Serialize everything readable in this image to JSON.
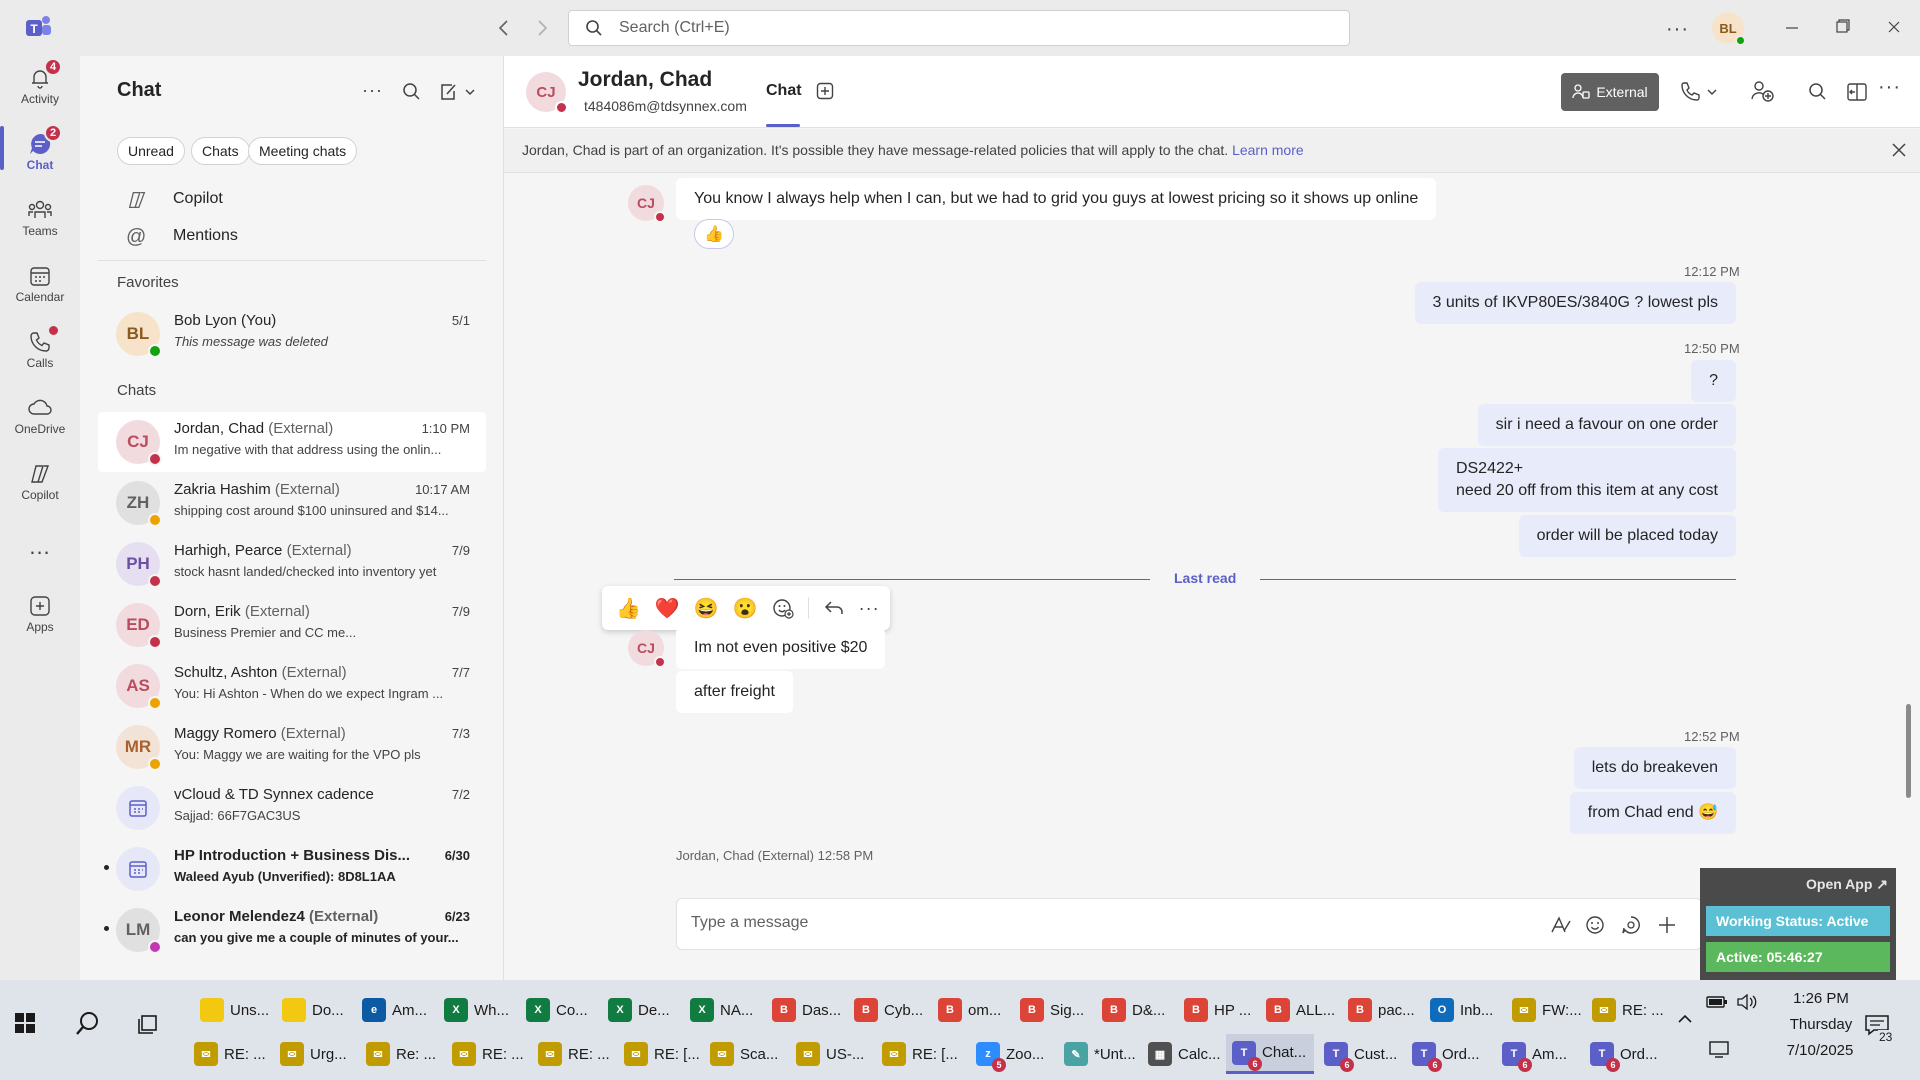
{
  "search": {
    "placeholder": "Search (Ctrl+E)"
  },
  "user": {
    "initials": "BL"
  },
  "rail": [
    {
      "label": "Activity",
      "badge": "4",
      "icon": "bell-icon"
    },
    {
      "label": "Chat",
      "badge": "2",
      "icon": "chat-icon"
    },
    {
      "label": "Teams",
      "icon": "teams-icon"
    },
    {
      "label": "Calendar",
      "icon": "calendar-icon"
    },
    {
      "label": "Calls",
      "icon": "phone-icon"
    },
    {
      "label": "OneDrive",
      "icon": "cloud-icon"
    },
    {
      "label": "Copilot",
      "icon": "copilot-icon"
    },
    {
      "label": "...",
      "icon": "more-icon"
    },
    {
      "label": "Apps",
      "icon": "apps-icon"
    }
  ],
  "chatlist": {
    "title": "Chat",
    "filters": [
      "Unread",
      "Chats",
      "Meeting chats"
    ],
    "pinned": [
      "Copilot",
      "Mentions"
    ],
    "favorites_header": "Favorites",
    "chats_header": "Chats",
    "favorites": [
      {
        "initials": "BL",
        "name": "Bob Lyon (You)",
        "ext": "",
        "time": "5/1",
        "preview": "This message was deleted"
      }
    ],
    "chats": [
      {
        "initials": "CJ",
        "name": "Jordan, Chad",
        "ext": "(External)",
        "time": "1:10 PM",
        "preview": "Im negative with that address using the onlin...",
        "avatar_bg": "#f1dbdf",
        "avatar_fg": "#b94c5e",
        "presence": "#c4314b"
      },
      {
        "initials": "ZH",
        "name": "Zakria Hashim",
        "ext": "(External)",
        "time": "10:17 AM",
        "preview": "shipping cost around $100 uninsured and $14...",
        "avatar_bg": "#e0e0e0",
        "avatar_fg": "#616161",
        "presence": "#eaa300"
      },
      {
        "initials": "PH",
        "name": "Harhigh, Pearce",
        "ext": "(External)",
        "time": "7/9",
        "preview": "stock hasnt landed/checked into inventory yet",
        "avatar_bg": "#e6dff2",
        "avatar_fg": "#6b4fa3",
        "presence": "#c4314b"
      },
      {
        "initials": "ED",
        "name": "Dorn, Erik",
        "ext": "(External)",
        "time": "7/9",
        "preview": "Business Premier and CC me...",
        "avatar_bg": "#f1dbdf",
        "avatar_fg": "#b94c5e",
        "presence": "#c4314b"
      },
      {
        "initials": "AS",
        "name": "Schultz, Ashton",
        "ext": "(External)",
        "time": "7/7",
        "preview": "You: Hi Ashton -  When do we expect Ingram ...",
        "avatar_bg": "#f1dbdf",
        "avatar_fg": "#b94c5e",
        "presence": "#eaa300"
      },
      {
        "initials": "MR",
        "name": "Maggy Romero",
        "ext": "(External)",
        "time": "7/3",
        "preview": "You: Maggy we are waiting for the VPO pls",
        "avatar_bg": "#f3e3d6",
        "avatar_fg": "#a8612f",
        "presence": "#eaa300"
      },
      {
        "initials": "",
        "name": "vCloud & TD Synnex cadence",
        "ext": "",
        "time": "7/2",
        "preview": "Sajjad: 66F7GAC3US",
        "avatar_bg": "#e6e8f8",
        "avatar_fg": "#5b5fc7",
        "presence": ""
      },
      {
        "initials": "",
        "name": "HP Introduction + Business Dis...",
        "ext": "",
        "time": "6/30",
        "preview": "Waleed Ayub (Unverified): 8D8L1AA",
        "avatar_bg": "#e6e8f8",
        "avatar_fg": "#5b5fc7",
        "presence": "",
        "bold": true
      },
      {
        "initials": "LM",
        "name": "Leonor Melendez4",
        "ext": "(External)",
        "time": "6/23",
        "preview": "can you give me a couple of minutes of your...",
        "avatar_bg": "#e0e0e0",
        "avatar_fg": "#616161",
        "presence": "#c239b3",
        "bold": true
      }
    ]
  },
  "header": {
    "initials": "CJ",
    "name": "Jordan, Chad",
    "email": "t484086m@tdsynnex.com",
    "tab": "Chat",
    "external_label": "External"
  },
  "infobar": {
    "text": "Jordan, Chad is part of an organization. It's possible they have message-related policies that will apply to the chat.",
    "link": "Learn more"
  },
  "messages": {
    "m1": "You know I always help when I can, but we had to grid you guys at lowest pricing so it shows up online",
    "m1_reaction": "👍",
    "t1": "12:12 PM",
    "m2": "3 units of IKVP80ES/3840G ? lowest pls",
    "t2": "12:50 PM",
    "m3": "?",
    "m4": "sir i need a favour on one order",
    "m5a": "DS2422+",
    "m5b": "need 20 off from this item at any cost",
    "m6": "order will be placed today",
    "last_read": "Last read",
    "m7": "Im not even positive $20",
    "m8": "after freight",
    "t3": "12:52 PM",
    "m9": "lets do breakeven",
    "m10": "from Chad end 😅",
    "next_sender": "Jordan, Chad (External)   12:58 PM"
  },
  "reactions": [
    "👍",
    "❤️",
    "😆",
    "😮"
  ],
  "composer": {
    "placeholder": "Type a message"
  },
  "widget": {
    "open": "Open App ↗",
    "status": "Working Status: Active",
    "active": "Active: 05:46:27"
  },
  "taskbar": {
    "row1": [
      {
        "label": "Uns...",
        "color": "#f2c811",
        "glyph": ""
      },
      {
        "label": "Do...",
        "color": "#f2c811",
        "glyph": ""
      },
      {
        "label": "Am...",
        "color": "#0c59a4",
        "glyph": "e"
      },
      {
        "label": "Wh...",
        "color": "#107c41",
        "glyph": "X"
      },
      {
        "label": "Co...",
        "color": "#107c41",
        "glyph": "X"
      },
      {
        "label": "De...",
        "color": "#107c41",
        "glyph": "X"
      },
      {
        "label": "NA...",
        "color": "#107c41",
        "glyph": "X"
      },
      {
        "label": "Das...",
        "color": "#db4437",
        "glyph": "B"
      },
      {
        "label": "Cyb...",
        "color": "#db4437",
        "glyph": "B"
      },
      {
        "label": "om...",
        "color": "#db4437",
        "glyph": "B"
      },
      {
        "label": "Sig...",
        "color": "#db4437",
        "glyph": "B"
      },
      {
        "label": "D&...",
        "color": "#db4437",
        "glyph": "B"
      },
      {
        "label": "HP ...",
        "color": "#db4437",
        "glyph": "B"
      },
      {
        "label": "ALL...",
        "color": "#db4437",
        "glyph": "B"
      },
      {
        "label": "pac...",
        "color": "#db4437",
        "glyph": "B"
      },
      {
        "label": "Inb...",
        "color": "#0f6cbd",
        "glyph": "O"
      },
      {
        "label": "FW:...",
        "color": "#c19c00",
        "glyph": "✉"
      },
      {
        "label": "RE: ...",
        "color": "#c19c00",
        "glyph": "✉"
      }
    ],
    "row2": [
      {
        "label": "RE: ...",
        "color": "#c19c00",
        "glyph": "✉"
      },
      {
        "label": "Urg...",
        "color": "#c19c00",
        "glyph": "✉"
      },
      {
        "label": "Re: ...",
        "color": "#c19c00",
        "glyph": "✉"
      },
      {
        "label": "RE: ...",
        "color": "#c19c00",
        "glyph": "✉"
      },
      {
        "label": "RE: ...",
        "color": "#c19c00",
        "glyph": "✉"
      },
      {
        "label": "RE: [...",
        "color": "#c19c00",
        "glyph": "✉"
      },
      {
        "label": "Sca...",
        "color": "#c19c00",
        "glyph": "✉"
      },
      {
        "label": "US-...",
        "color": "#c19c00",
        "glyph": "✉"
      },
      {
        "label": "RE: [...",
        "color": "#c19c00",
        "glyph": "✉"
      },
      {
        "label": "Zoo...",
        "color": "#2d8cff",
        "glyph": "z",
        "badge": "5"
      },
      {
        "label": "*Unt...",
        "color": "#4aa3a3",
        "glyph": "✎"
      },
      {
        "label": "Calc...",
        "color": "#505050",
        "glyph": "▦"
      },
      {
        "label": "Chat...",
        "color": "#5b5fc7",
        "glyph": "T",
        "badge": "6"
      },
      {
        "label": "Cust...",
        "color": "#5b5fc7",
        "glyph": "T",
        "badge": "6"
      },
      {
        "label": "Ord...",
        "color": "#5b5fc7",
        "glyph": "T",
        "badge": "6"
      },
      {
        "label": "Am...",
        "color": "#5b5fc7",
        "glyph": "T",
        "badge": "6"
      },
      {
        "label": "Ord...",
        "color": "#5b5fc7",
        "glyph": "T",
        "badge": "6"
      }
    ]
  },
  "tray": {
    "time": "1:26 PM",
    "day": "Thursday",
    "date": "7/10/2025",
    "notif": "23"
  },
  "colors": {
    "accent": "#5b5fc7",
    "mine_bubble": "#e8ebfa",
    "busy": "#c4314b"
  }
}
